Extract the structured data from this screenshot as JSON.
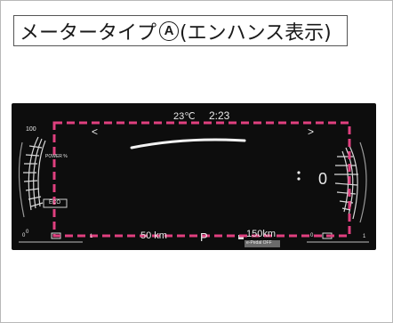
{
  "header": {
    "title_prefix": "メータータイプ",
    "badge_letter": "A",
    "title_suffix": "(エンハンス表示)"
  },
  "cluster": {
    "temperature": "23℃",
    "time": "2:23",
    "left_arrow": "<",
    "right_arrow": ">",
    "power_scale_top": "100",
    "power_label": "POWER %",
    "eco_label": "ECO",
    "power_scale_bottom": "0",
    "speed_value": "0",
    "range": "50 km",
    "shift_position": "P",
    "odometer": "150km",
    "epedal_status": "e-Pedal OFF",
    "fuel_scale_left": "0",
    "fuel_scale_right": "1",
    "battery_scale_left": "0",
    "battery_scale_right": "1",
    "highlight_color": "#e0407f",
    "background_color": "#0d0d0d"
  }
}
